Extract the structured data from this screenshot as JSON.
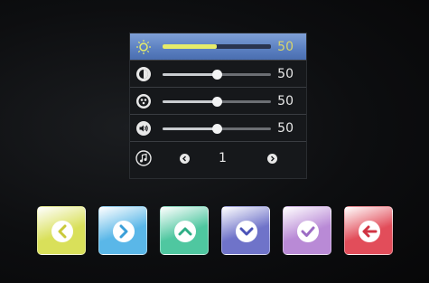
{
  "menu": {
    "rows": [
      {
        "icon": "brightness-icon",
        "value": "50",
        "level": 0.5,
        "selected": true
      },
      {
        "icon": "contrast-icon",
        "value": "50",
        "level": 0.5,
        "selected": false
      },
      {
        "icon": "color-icon",
        "value": "50",
        "level": 0.5,
        "selected": false
      },
      {
        "icon": "volume-icon",
        "value": "50",
        "level": 0.5,
        "selected": false
      }
    ],
    "tone": {
      "icon": "music-note-icon",
      "value": "1"
    }
  },
  "buttons": [
    {
      "name": "left-button",
      "icon": "chevron-left-icon",
      "color": "#d9e05a",
      "icon_color": "#c9c93a"
    },
    {
      "name": "right-button",
      "icon": "chevron-right-icon",
      "color": "#5ab7e8",
      "icon_color": "#3a9fd8"
    },
    {
      "name": "up-button",
      "icon": "chevron-up-icon",
      "color": "#4fc7a0",
      "icon_color": "#2fae86"
    },
    {
      "name": "down-button",
      "icon": "chevron-down-icon",
      "color": "#6f73c9",
      "icon_color": "#4c54b8"
    },
    {
      "name": "confirm-button",
      "icon": "checkmark-icon",
      "color": "#b98ad6",
      "icon_color": "#9c6cc4"
    },
    {
      "name": "back-button",
      "icon": "back-arrow-icon",
      "color": "#e24d5a",
      "icon_color": "#d03444"
    }
  ]
}
